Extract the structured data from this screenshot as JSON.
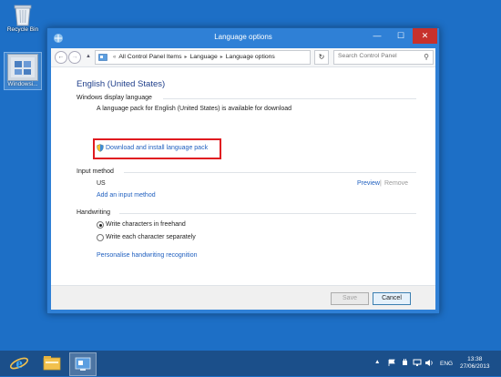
{
  "desktop": {
    "icons": [
      {
        "label": "Recycle Bin",
        "icon": "recycle-bin-icon"
      },
      {
        "label": "Windowsi...",
        "icon": "installer-file-icon"
      }
    ]
  },
  "window": {
    "title": "Language options",
    "controls": {
      "minimize": "—",
      "maximize": "☐",
      "close": "✕"
    },
    "nav": {
      "back": "←",
      "forward": "→",
      "up": "▲"
    },
    "breadcrumb": [
      "All Control Panel Items",
      "Language",
      "Language options"
    ],
    "address_dropdown": "▼",
    "refresh": "↻",
    "search_placeholder": "Search Control Panel",
    "search_icon": "⚲"
  },
  "content": {
    "heading": "English (United States)",
    "display_section": {
      "title": "Windows display language",
      "notice": "A language pack for English (United States) is available for download",
      "download_link": "Download and install language pack"
    },
    "input_section": {
      "title": "Input method",
      "method": "US",
      "preview": "Preview",
      "divider": "|",
      "remove": "Remove",
      "add_link": "Add an input method"
    },
    "handwriting_section": {
      "title": "Handwriting",
      "options": [
        {
          "label": "Write characters in freehand",
          "selected": true
        },
        {
          "label": "Write each character separately",
          "selected": false
        }
      ],
      "personalise_link": "Personalise handwriting recognition"
    }
  },
  "footer": {
    "save": "Save",
    "cancel": "Cancel"
  },
  "taskbar": {
    "tray": {
      "arrow": "▲",
      "language": "ENG"
    },
    "time": "13:38",
    "date": "27/06/2013"
  },
  "colors": {
    "highlight": "#e01a20",
    "link": "#1f5fbf",
    "heading": "#1e3e8a",
    "desktop": "#1d6fc6"
  }
}
